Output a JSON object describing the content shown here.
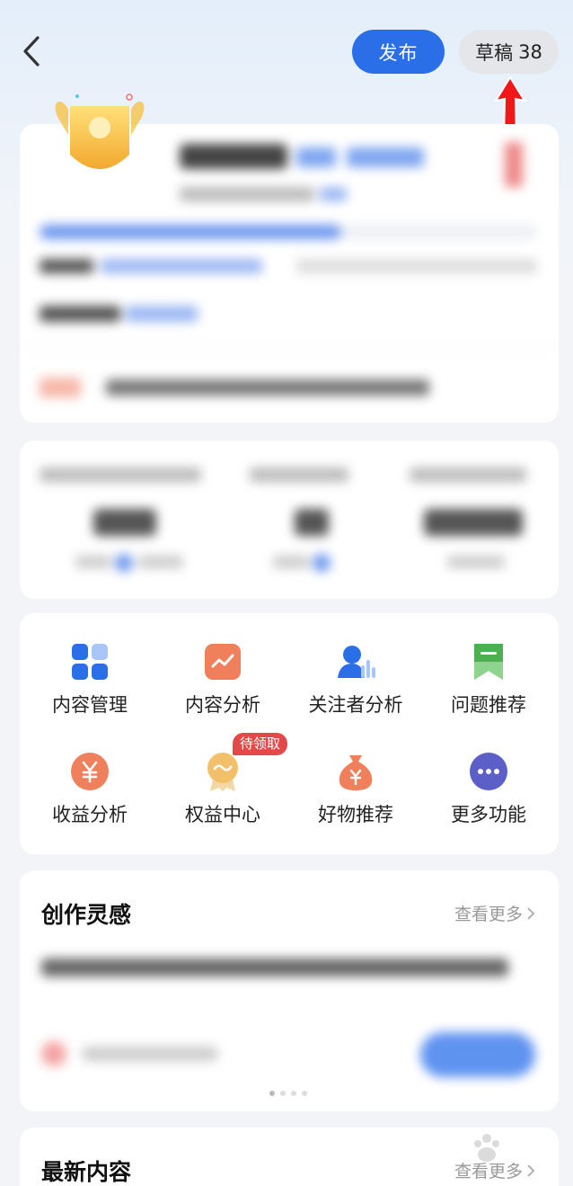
{
  "header": {
    "publish_label": "发布",
    "drafts_label": "草稿",
    "drafts_count": "38"
  },
  "functions": [
    {
      "label": "内容管理",
      "icon": "grid-apps-icon"
    },
    {
      "label": "内容分析",
      "icon": "trend-chart-icon"
    },
    {
      "label": "关注者分析",
      "icon": "follower-chart-icon"
    },
    {
      "label": "问题推荐",
      "icon": "bookmark-flag-icon"
    },
    {
      "label": "收益分析",
      "icon": "yuan-coin-icon"
    },
    {
      "label": "权益中心",
      "icon": "medal-icon"
    },
    {
      "label": "好物推荐",
      "icon": "money-bag-icon"
    },
    {
      "label": "更多功能",
      "icon": "more-dots-icon"
    }
  ],
  "pending_tag": "待领取",
  "inspiration": {
    "title": "创作灵感",
    "more_label": "查看更多"
  },
  "latest": {
    "title": "最新内容",
    "more_label": "查看更多"
  },
  "colors": {
    "primary": "#2a6fe8",
    "tag_red": "#e54848",
    "orange": "#f07f5c",
    "green": "#4cb050",
    "purple": "#5b5fc7"
  }
}
